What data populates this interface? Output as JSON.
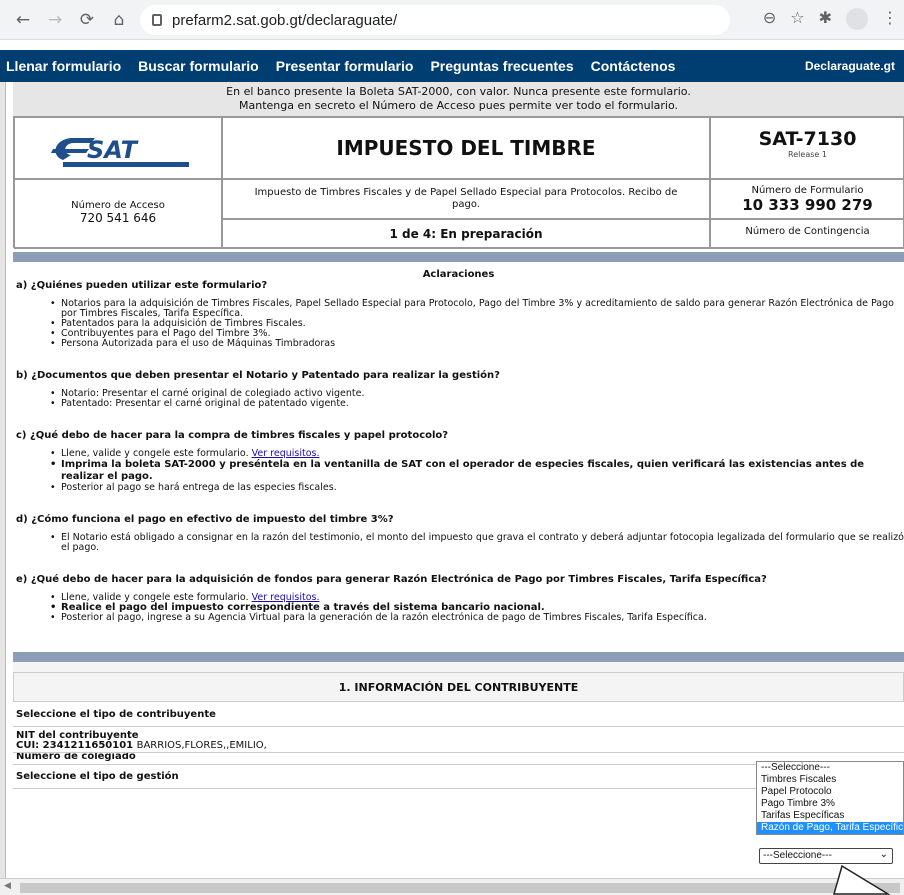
{
  "browser": {
    "url": "prefarm2.sat.gob.gt/declaraguate/"
  },
  "nav": {
    "items": [
      "Llenar formulario",
      "Buscar formulario",
      "Presentar formulario",
      "Preguntas frecuentes",
      "Contáctenos"
    ],
    "brand": "Declaraguate.gt"
  },
  "banner": {
    "line1": "En el banco presente la Boleta SAT-2000, con valor. Nunca presente este formulario.",
    "line2": "Mantenga en secreto el Número de Acceso pues permite ver todo el formulario."
  },
  "header": {
    "title": "IMPUESTO DEL TIMBRE",
    "form_code": "SAT-7130",
    "release": "Release 1",
    "access_label": "Número de Acceso",
    "access_number": "720 541 646",
    "description": "Impuesto de Timbres Fiscales y de Papel Sellado Especial para Protocolos. Recibo de pago.",
    "form_number_label": "Número de Formulario",
    "form_number": "10 333 990 279",
    "state": "1 de 4: En preparación",
    "contingency_label": "Número de Contingencia"
  },
  "clarifications": {
    "title": "Aclaraciones",
    "a": {
      "q": "a) ¿Quiénes pueden utilizar este formulario?",
      "items": [
        "Notarios para la adquisición de Timbres Fiscales, Papel Sellado Especial para Protocolo, Pago del Timbre 3% y acreditamiento de saldo para generar Razón Electrónica de Pago por Timbres Fiscales, Tarifa Específica.",
        "Patentados para la adquisición de Timbres Fiscales.",
        "Contribuyentes para el Pago del Timbre 3%.",
        "Persona Autorizada para el uso de Máquinas Timbradoras"
      ]
    },
    "b": {
      "q": "b) ¿Documentos que deben presentar el Notario y Patentado para realizar la gestión?",
      "items": [
        "Notario: Presentar el carné original de colegiado activo vigente.",
        "Patentado: Presentar el carné original de patentado vigente."
      ]
    },
    "c": {
      "q": "c) ¿Qué debo de hacer para la compra de timbres fiscales y papel protocolo?",
      "item1": "Llene, valide y congele este formulario.",
      "link": "Ver requisitos.",
      "item2": "Imprima la boleta SAT-2000 y preséntela en la ventanilla de SAT con el operador de especies fiscales, quien verificará las existencias antes de realizar el pago.",
      "item3": "Posterior al pago se hará entrega de las especies fiscales."
    },
    "d": {
      "q": "d) ¿Cómo funciona el pago en efectivo de impuesto del timbre 3%?",
      "items": [
        "El Notario está obligado a consignar en la razón del testimonio, el monto del impuesto que grava el contrato y deberá adjuntar fotocopia legalizada del formulario que se realizó el pago."
      ]
    },
    "e": {
      "q": "e) ¿Qué debo de hacer para la adquisición de fondos para generar Razón Electrónica de Pago por Timbres Fiscales, Tarifa Específica?",
      "item1": "Llene, valide y congele este formulario.",
      "link": "Ver requisitos.",
      "item2": "Realice el pago del impuesto correspondiente a través del sistema bancario nacional.",
      "item3": "Posterior al pago, ingrese a su Agencia Virtual para la generación de la razón electrónica de pago de Timbres Fiscales, Tarifa Específica."
    }
  },
  "section1": {
    "title": "1. INFORMACIÓN DEL CONTRIBUYENTE",
    "taxpayer_type_label": "Seleccione el tipo de contribuyente",
    "nit_label": "NIT del contribuyente",
    "cui_label": "CUI: 2341211650101",
    "cui_name": "BARRIOS,FLORES,,EMILIO,",
    "colegiado_label": "Número de colegiado",
    "gestion_label": "Seleccione el tipo de gestión",
    "gestion_selected": "---Seleccione---"
  },
  "dropdown": {
    "options": [
      "---Seleccione---",
      "Timbres Fiscales",
      "Papel Protocolo",
      "Pago Timbre 3%",
      "Tarifas Específicas",
      "Razón de Pago, Tarifa Específica"
    ],
    "highlighted_index": 5
  }
}
